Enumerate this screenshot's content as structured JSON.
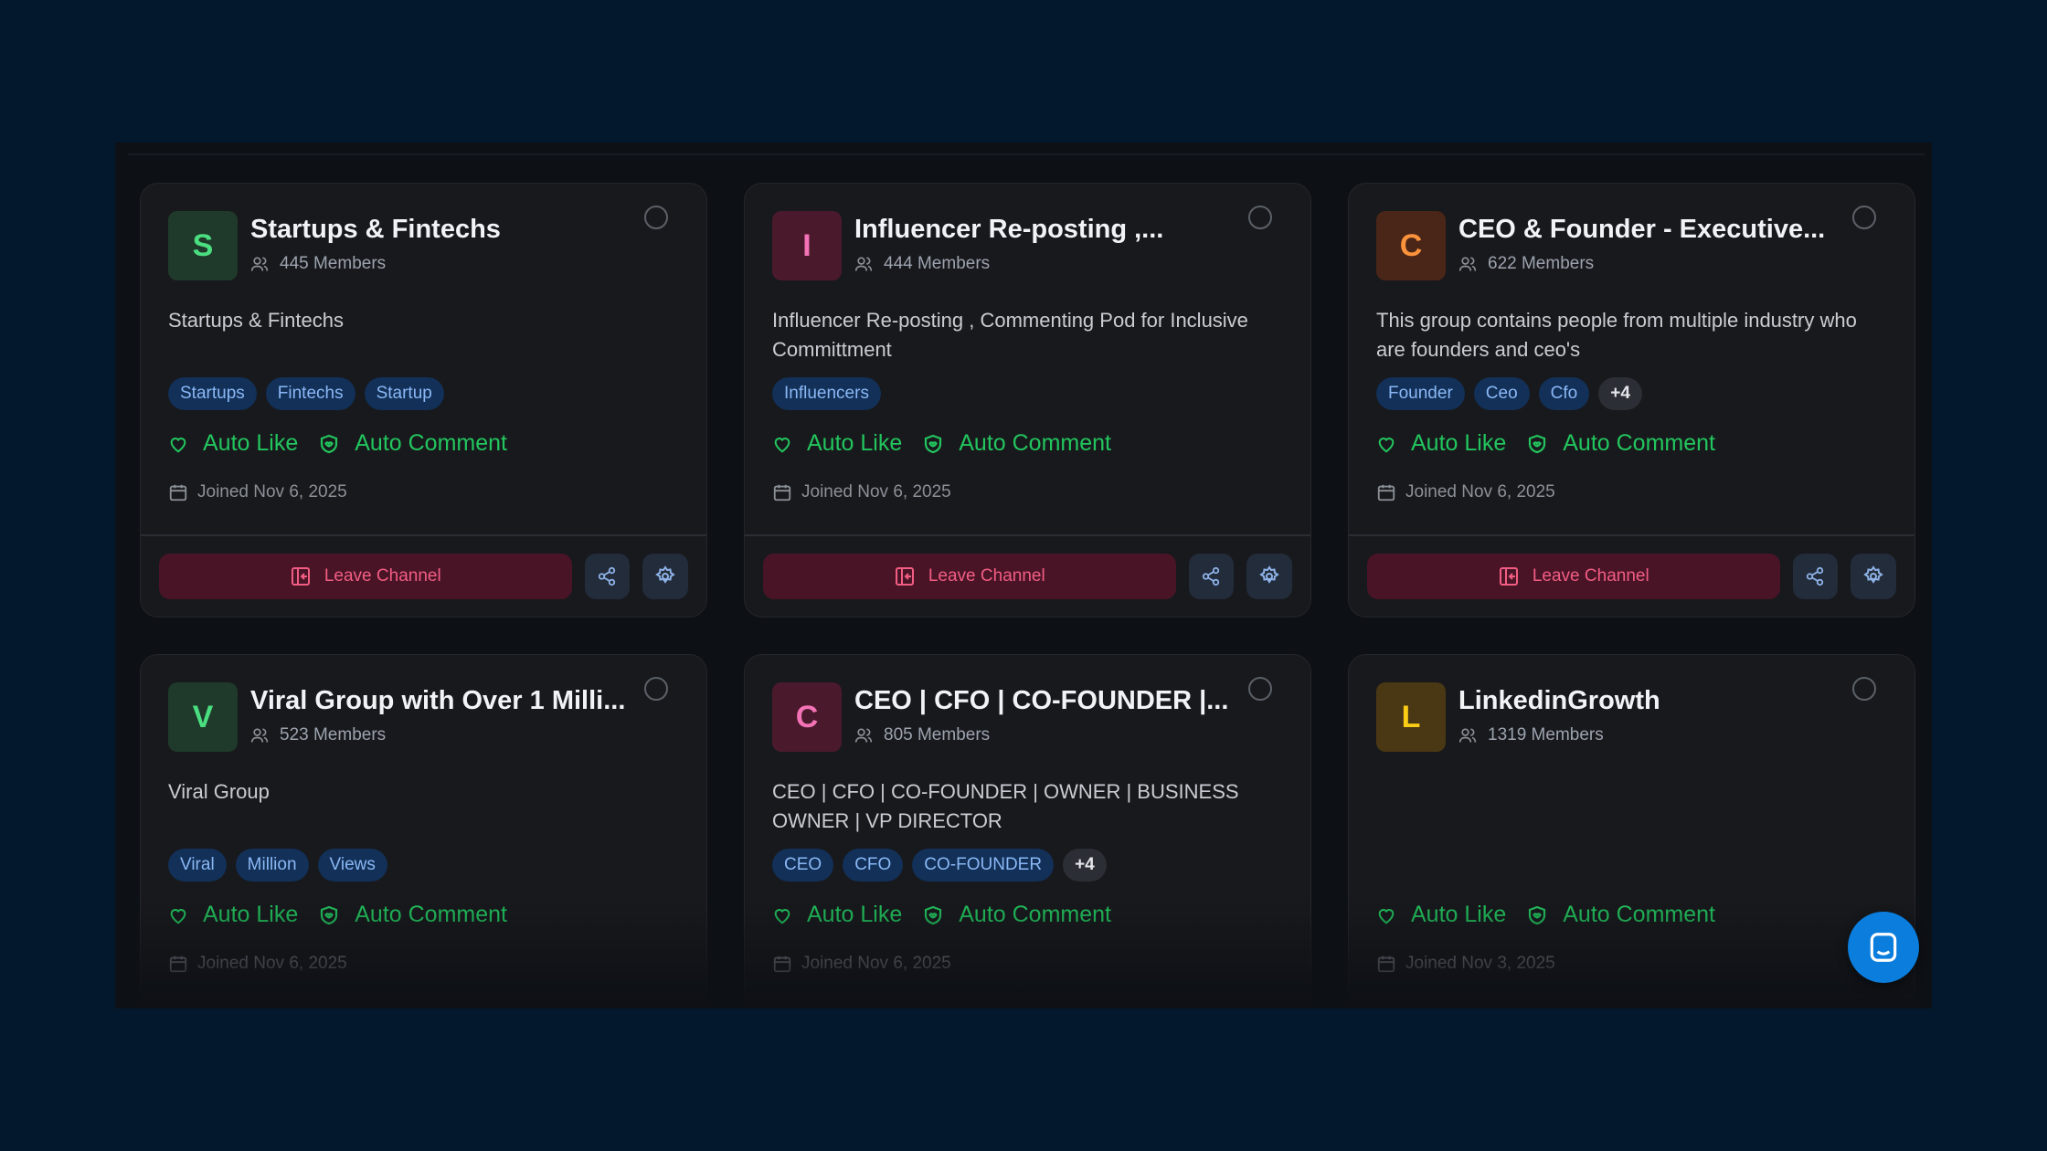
{
  "cards": [
    {
      "avatar_letter": "S",
      "title": "Startups & Fintechs",
      "members": "445 Members",
      "description": "Startups & Fintechs",
      "tags": [
        "Startups",
        "Fintechs",
        "Startup"
      ],
      "more_tags": "",
      "auto_like": "Auto Like",
      "auto_comment": "Auto Comment",
      "joined": "Joined Nov 6, 2025",
      "leave_label": "Leave Channel"
    },
    {
      "avatar_letter": "I",
      "title": "Influencer Re-posting ,...",
      "members": "444 Members",
      "description": "Influencer Re-posting , Commenting Pod for Inclusive Committment",
      "tags": [
        "Influencers"
      ],
      "more_tags": "",
      "auto_like": "Auto Like",
      "auto_comment": "Auto Comment",
      "joined": "Joined Nov 6, 2025",
      "leave_label": "Leave Channel"
    },
    {
      "avatar_letter": "C",
      "title": "CEO & Founder - Executive...",
      "members": "622 Members",
      "description": "This group contains people from multiple industry who are founders and ceo's",
      "tags": [
        "Founder",
        "Ceo",
        "Cfo"
      ],
      "more_tags": "+4",
      "auto_like": "Auto Like",
      "auto_comment": "Auto Comment",
      "joined": "Joined Nov 6, 2025",
      "leave_label": "Leave Channel"
    },
    {
      "avatar_letter": "V",
      "title": "Viral Group with Over 1 Milli...",
      "members": "523 Members",
      "description": "Viral Group",
      "tags": [
        "Viral",
        "Million",
        "Views"
      ],
      "more_tags": "",
      "auto_like": "Auto Like",
      "auto_comment": "Auto Comment",
      "joined": "Joined Nov 6, 2025",
      "leave_label": ""
    },
    {
      "avatar_letter": "C",
      "title": "CEO | CFO | CO-FOUNDER |...",
      "members": "805 Members",
      "description": "CEO | CFO | CO-FOUNDER | OWNER | BUSINESS OWNER | VP DIRECTOR",
      "tags": [
        "CEO",
        "CFO",
        "CO-FOUNDER"
      ],
      "more_tags": "+4",
      "auto_like": "Auto Like",
      "auto_comment": "Auto Comment",
      "joined": "Joined Nov 6, 2025",
      "leave_label": ""
    },
    {
      "avatar_letter": "L",
      "title": "LinkedinGrowth",
      "members": "1319 Members",
      "description": "",
      "tags": [],
      "more_tags": "",
      "auto_like": "Auto Like",
      "auto_comment": "Auto Comment",
      "joined": "Joined Nov 3, 2025",
      "leave_label": ""
    }
  ],
  "colors": {
    "avatar_green_bg": "#1f3a2b",
    "avatar_green_fg": "#4ade80",
    "avatar_pink_bg": "#4a1a2c",
    "avatar_pink_fg": "#f472b6",
    "avatar_orange_bg": "#4a2618",
    "avatar_orange_fg": "#fb923c",
    "avatar_yellow_bg": "#4a3714",
    "avatar_yellow_fg": "#facc15",
    "accent_green": "#22c55e",
    "leave_red": "#f25d83",
    "chat_blue": "#0b7ddc"
  },
  "icons": {
    "members": "users-icon",
    "like": "heart-icon",
    "comment": "shield-comment-icon",
    "joined": "calendar-icon",
    "leave": "exit-icon",
    "share": "share-icon",
    "settings": "gear-icon",
    "chat": "chat-icon"
  }
}
